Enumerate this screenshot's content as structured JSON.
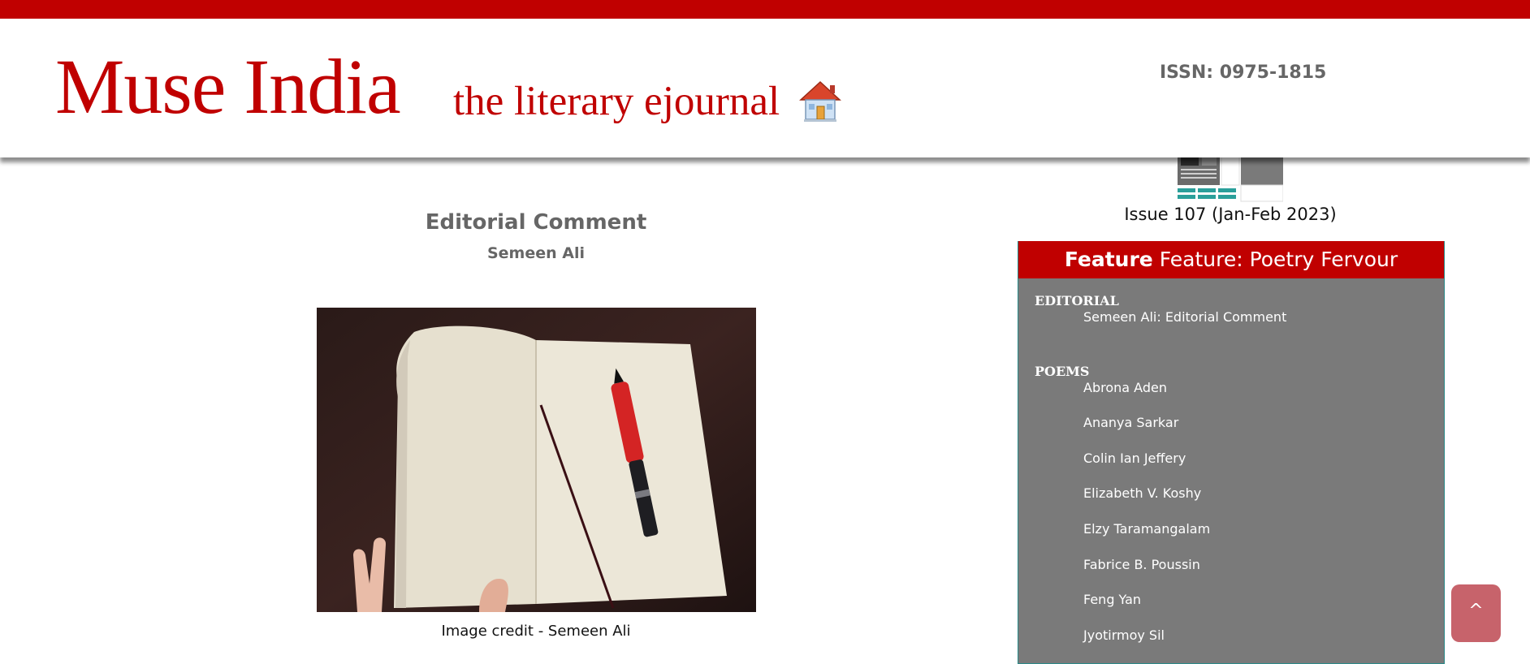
{
  "header": {
    "brand": "Muse India",
    "tagline": "the literary ejournal",
    "issn": "ISSN: 0975-1815",
    "home_icon": "home-icon"
  },
  "issue": {
    "label": "Issue 107 (Jan-Feb 2023)"
  },
  "article": {
    "title": "Editorial Comment",
    "author": "Semeen Ali",
    "image_caption": "Image credit - Semeen Ali"
  },
  "feature": {
    "heading_bold": "Feature",
    "heading_rest": "Feature: Poetry Fervour",
    "sections": [
      {
        "title": "EDITORIAL",
        "items": [
          "Semeen Ali: Editorial Comment"
        ]
      },
      {
        "title": "POEMS",
        "items": [
          "Abrona Aden",
          "Ananya Sarkar",
          "Colin Ian Jeffery",
          "Elizabeth V. Koshy",
          "Elzy Taramangalam",
          "Fabrice B. Poussin",
          "Feng Yan",
          "Jyotirmoy Sil"
        ]
      }
    ]
  },
  "scroll_top": {
    "label": "^"
  },
  "colors": {
    "brand_red": "#c00000",
    "panel_gray": "#7a7a7a",
    "scroll_button": "#c7636b"
  }
}
